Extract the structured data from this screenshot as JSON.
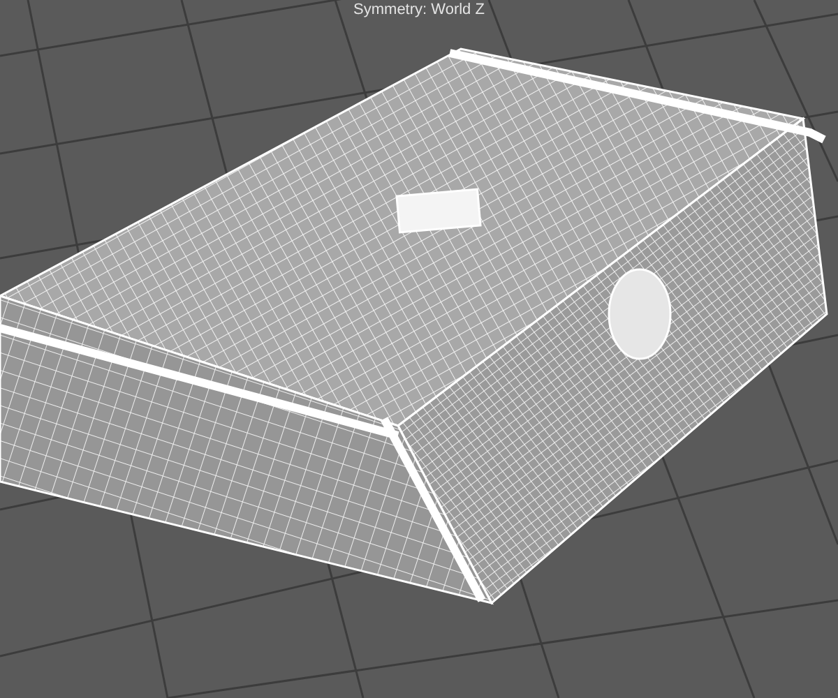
{
  "viewport": {
    "hud_label": "Symmetry: World Z"
  }
}
